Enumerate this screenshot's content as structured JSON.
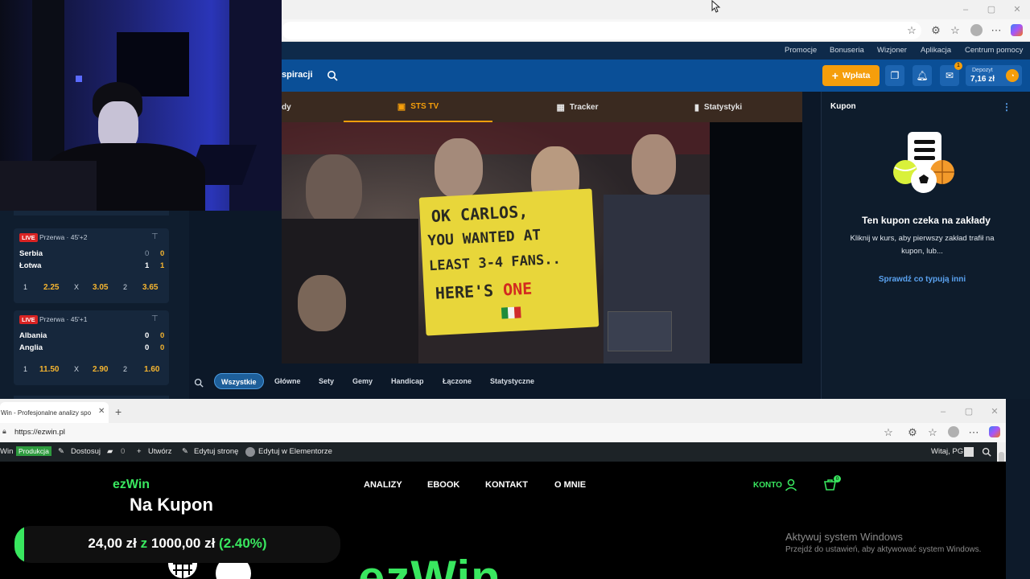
{
  "top_browser": {
    "window_controls": [
      "–",
      "▢",
      "✕"
    ]
  },
  "sts": {
    "topnav": [
      "Promocje",
      "Bonuseria",
      "Wizjoner",
      "Aplikacja",
      "Centrum pomocy"
    ],
    "header": {
      "nav_partial": "spiracji",
      "deposit_button": "Wpłata",
      "deposit_label": "Depozyt",
      "deposit_amount": "7,16 zł",
      "notif_badge": "1"
    },
    "video_tabs": [
      {
        "label": "dy",
        "icon": "list-icon"
      },
      {
        "label": "STS TV",
        "icon": "tv-icon",
        "active": true
      },
      {
        "label": "Tracker",
        "icon": "tracker-icon"
      },
      {
        "label": "Statystyki",
        "icon": "stats-icon"
      }
    ],
    "video_banner": {
      "line1": "OK CARLOS,",
      "line2": "YOU WANTED AT",
      "line3": "LEAST 3-4 FANS..",
      "line4a": "HERE'S",
      "line4b": "ONE"
    },
    "matches": [
      {
        "live": "LIVE",
        "status": "Przerwa · 45'+2",
        "home": "Serbia",
        "away": "Łotwa",
        "home_score_half": "0",
        "home_score": "0",
        "away_score_half": "1",
        "away_score": "1",
        "odds": [
          {
            "k": "1",
            "v": "2.25"
          },
          {
            "k": "X",
            "v": "3.05"
          },
          {
            "k": "2",
            "v": "3.65"
          }
        ]
      },
      {
        "live": "LIVE",
        "status": "Przerwa · 45'+1",
        "home": "Albania",
        "away": "Anglia",
        "home_score_half": "0",
        "home_score": "0",
        "away_score_half": "0",
        "away_score": "0",
        "odds": [
          {
            "k": "1",
            "v": "11.50"
          },
          {
            "k": "X",
            "v": "2.90"
          },
          {
            "k": "2",
            "v": "1.60"
          }
        ]
      }
    ],
    "filters": [
      "Wszystkie",
      "Główne",
      "Sety",
      "Gemy",
      "Handicap",
      "Łączone",
      "Statystyczne"
    ],
    "coupon": {
      "title": "Kupon",
      "empty_title": "Ten kupon czeka na zakłady",
      "empty_text_1": "Kliknij w kurs, aby pierwszy zakład trafił na",
      "empty_text_2": "kupon, lub...",
      "link": "Sprawdź co typują inni"
    }
  },
  "bottom_browser": {
    "tab_title": "Win - Profesjonalne analizy spo",
    "url": "https://ezwin.pl",
    "wp_bar": {
      "site": "Win",
      "badge": "Produkcja",
      "customize": "Dostosuj",
      "comments": "0",
      "new": "Utwórz",
      "edit": "Edytuj stronę",
      "elementor": "Edytuj w Elementorze",
      "greeting": "Witaj, PG"
    }
  },
  "ezwin": {
    "logo": "ezWin",
    "nav": [
      "ANALIZY",
      "EBOOK",
      "KONTAKT",
      "O MNIE"
    ],
    "account": "KONTO",
    "cart_badge": "0",
    "hero_partial": "ezWin"
  },
  "overlay": {
    "title": "Na Kupon",
    "current": "24,00 zł",
    "separator": "z",
    "target": "1000,00 zł",
    "percent": "(2.40%)",
    "progress": 0.024
  },
  "watermark": {
    "line1": "Aktywuj system Windows",
    "line2": "Przejdź do ustawień, aby aktywować system Windows."
  },
  "colors": {
    "sts_blue": "#0a4f97",
    "accent_orange": "#f59e0b",
    "ezwin_green": "#39e75f",
    "odds_orange": "#f5b530"
  }
}
